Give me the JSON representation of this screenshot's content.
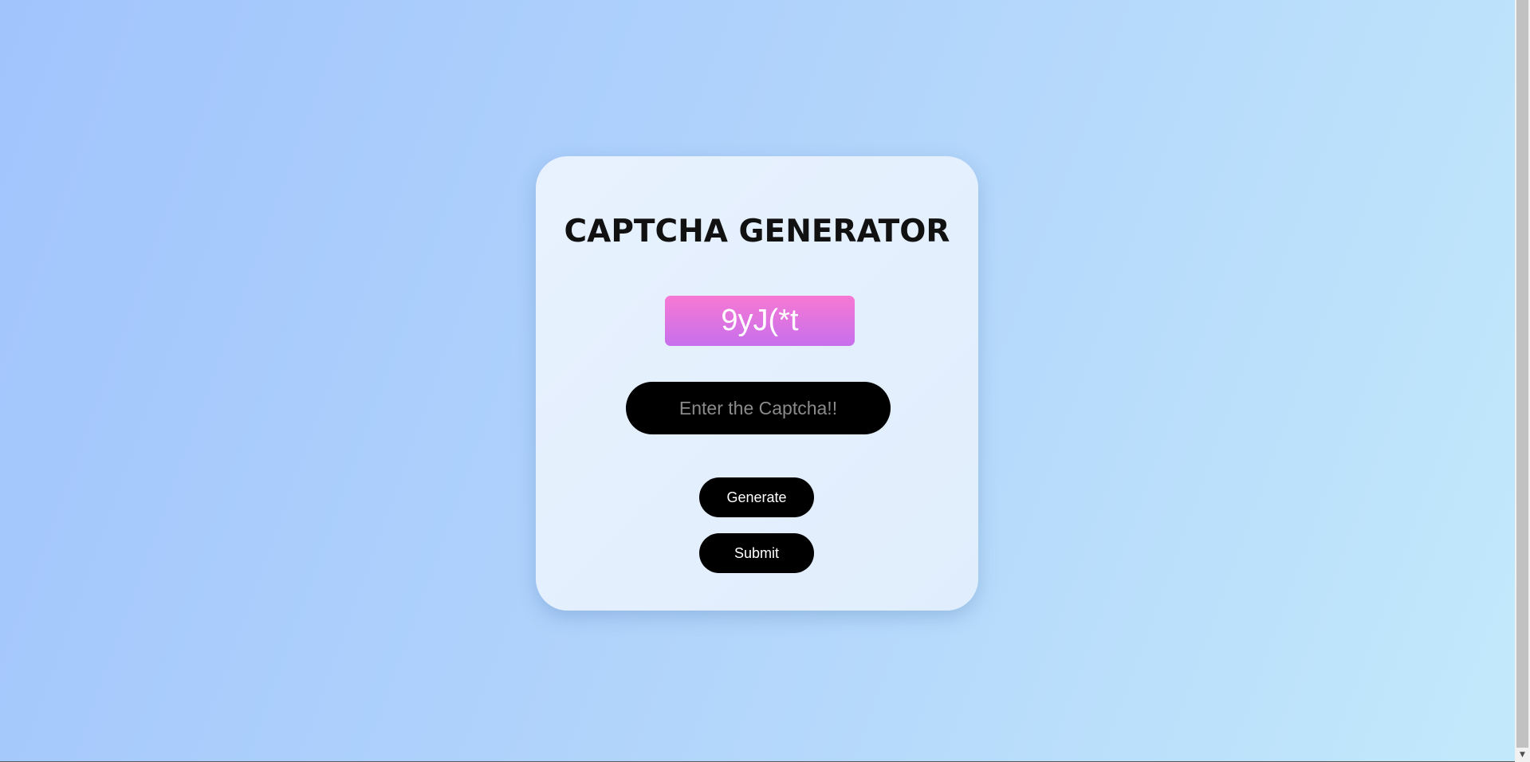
{
  "app": {
    "title": "CAPTCHA GENERATOR"
  },
  "captcha": {
    "code": "9yJ(*t",
    "gradient_top": "#f779d4",
    "gradient_bottom": "#c76fec"
  },
  "input": {
    "placeholder": "Enter the Captcha!!",
    "value": ""
  },
  "buttons": {
    "generate_label": "Generate",
    "submit_label": "Submit"
  },
  "colors": {
    "background_start": "#a1c4fd",
    "background_end": "#c2e9fb",
    "card": "#e4effd",
    "button": "#000000",
    "button_text": "#ffffff"
  },
  "scrollbar": {
    "arrow_icon": "scroll-down-arrow-icon"
  }
}
